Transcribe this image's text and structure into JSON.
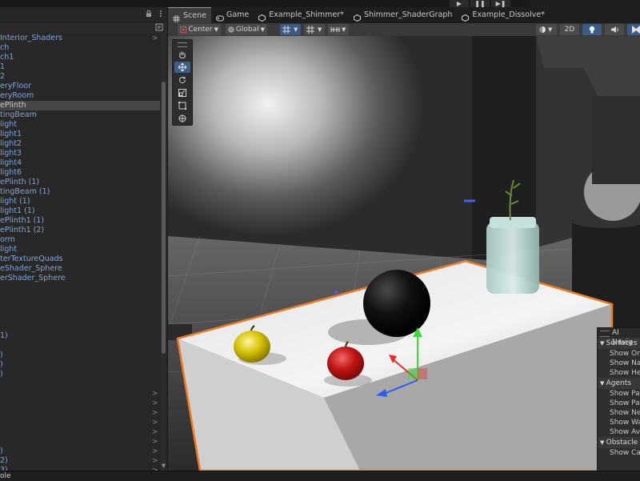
{
  "playbar": {
    "play": "▶",
    "pause": "❚❚",
    "step": "▶❚"
  },
  "hierarchy": {
    "items": [
      {
        "label": "Interior_Shaders",
        "expand": ">"
      },
      {
        "label": "ch"
      },
      {
        "label": "ch1"
      },
      {
        "label": "1"
      },
      {
        "label": "2"
      },
      {
        "label": "eryFloor"
      },
      {
        "label": "eryRoom"
      },
      {
        "label": "ePlinth",
        "selected": true
      },
      {
        "label": "tingBeam"
      },
      {
        "label": "light"
      },
      {
        "label": "light1"
      },
      {
        "label": "light2"
      },
      {
        "label": "light3"
      },
      {
        "label": "light4"
      },
      {
        "label": "light6"
      },
      {
        "label": "ePlinth (1)"
      },
      {
        "label": "tingBeam (1)"
      },
      {
        "label": "light (1)"
      },
      {
        "label": "light1 (1)"
      },
      {
        "label": "ePlinth1 (1)"
      },
      {
        "label": "ePlinth1 (2)"
      },
      {
        "label": "orm"
      },
      {
        "label": "light"
      },
      {
        "label": "terTextureQuads"
      },
      {
        "label": "eShader_Sphere"
      },
      {
        "label": "erShader_Sphere"
      },
      {
        "label": ""
      },
      {
        "label": ""
      },
      {
        "label": ""
      },
      {
        "label": ""
      },
      {
        "label": ""
      },
      {
        "label": "1)"
      },
      {
        "label": ""
      },
      {
        "label": ")"
      },
      {
        "label": ")"
      },
      {
        "label": ")"
      },
      {
        "label": ""
      },
      {
        "label": "",
        "expand": ">"
      },
      {
        "label": "",
        "expand": ">"
      },
      {
        "label": "",
        "expand": ">"
      },
      {
        "label": "",
        "expand": ">"
      },
      {
        "label": "",
        "expand": ">"
      },
      {
        "label": "",
        "expand": ">"
      },
      {
        "label": ")",
        "expand": ">"
      },
      {
        "label": "2)",
        "expand": ">"
      },
      {
        "label": "3)",
        "expand": ">"
      }
    ]
  },
  "tabs": [
    {
      "label": "Scene",
      "icon": "grid-icon",
      "active": true
    },
    {
      "label": "Game",
      "icon": "gamepad-icon"
    },
    {
      "label": "Example_Shimmer*",
      "icon": "unity-scene-icon"
    },
    {
      "label": "Shimmer_ShaderGraph",
      "icon": "unity-scene-icon"
    },
    {
      "label": "Example_Dissolve*",
      "icon": "unity-scene-icon"
    }
  ],
  "toolbar": {
    "pivot": "Center",
    "space": "Global",
    "mode_2d": "2D"
  },
  "ai_navigation": {
    "title": "AI Navig",
    "sections": [
      {
        "title": "Surfaces",
        "items": [
          "Show On",
          "Show Na",
          "Show He"
        ]
      },
      {
        "title": "Agents",
        "items": [
          "Show Pat",
          "Show Pat",
          "Show Ne",
          "Show Wa",
          "Show Av"
        ]
      },
      {
        "title": "Obstacle",
        "items": [
          "Show Ca"
        ]
      }
    ]
  },
  "status": {
    "text": "ole"
  },
  "colors": {
    "selection_outline": "#f07820",
    "hierarchy_text": "#7ea6e0",
    "accent": "#58a6ff"
  }
}
